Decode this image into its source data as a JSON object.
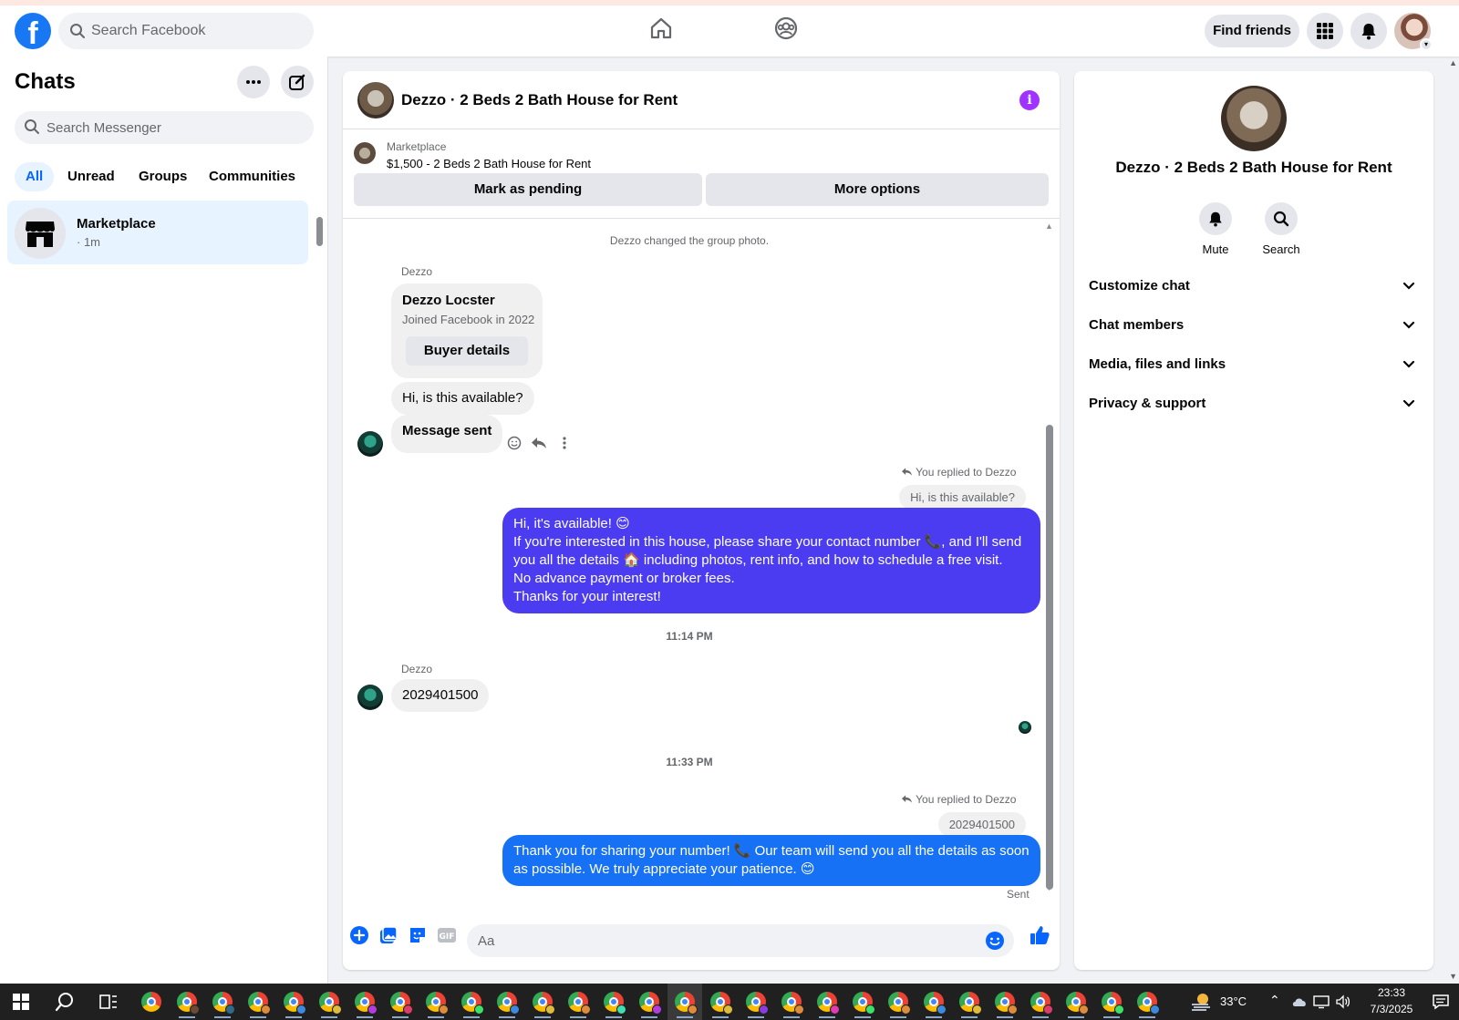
{
  "topbar": {
    "search_placeholder": "Search Facebook",
    "find_friends": "Find friends"
  },
  "left": {
    "title": "Chats",
    "search_placeholder": "Search Messenger",
    "filters": [
      "All",
      "Unread",
      "Groups",
      "Communities"
    ],
    "chat": {
      "name": "Marketplace",
      "time": "· 1m"
    }
  },
  "convo": {
    "title": "Dezzo · 2 Beds 2 Bath House for Rent",
    "marketplace_label": "Marketplace",
    "listing": "$1,500 - 2 Beds 2 Bath House for Rent",
    "mark_pending": "Mark as pending",
    "more_options": "More options",
    "group_photo_notice": "Dezzo changed the group photo.",
    "sender1": "Dezzo",
    "buyer_name": "Dezzo Locster",
    "buyer_joined": "Joined Facebook in 2022",
    "buyer_details": "Buyer details",
    "msg1": "Hi, is this available?",
    "msg2": "Message sent",
    "replied_label": "You replied to Dezzo",
    "quote1": "Hi, is this available?",
    "out1_lines": [
      "Hi, it's available! 😊",
      "If you're interested in this house, please share your contact number 📞, and I'll send",
      "you all the details 🏠 including photos, rent info, and how to schedule a free visit.",
      "No advance payment or broker fees.",
      "Thanks for your interest!"
    ],
    "time1": "11:14 PM",
    "sender2": "Dezzo",
    "msg3": "2029401500",
    "time2": "11:33 PM",
    "replied_label2": "You replied to Dezzo",
    "quote2": "2029401500",
    "out2_lines": [
      "Thank you for sharing your number! 📞 Our team will send you all the details as soon",
      "as possible. We truly appreciate your patience. 😊"
    ],
    "status": "Sent",
    "composer_placeholder": "Aa",
    "colors": {
      "out1": "#4b3cf2",
      "out2": "#1671f5",
      "accent": "#0866ff"
    }
  },
  "right": {
    "name": "Dezzo · 2 Beds 2 Bath House for Rent",
    "actions": [
      "Mute",
      "Search"
    ],
    "sections": [
      "Customize chat",
      "Chat members",
      "Media, files and links",
      "Privacy & support"
    ]
  },
  "taskbar": {
    "temperature": "33°C",
    "time": "23:33",
    "date": "7/3/2025"
  }
}
